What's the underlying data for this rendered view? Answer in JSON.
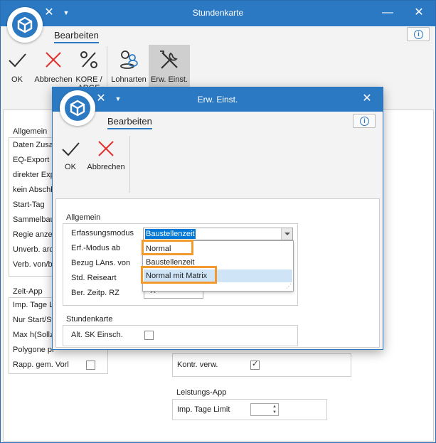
{
  "main_window": {
    "title": "Stundenkarte",
    "ribbon_tab": "Bearbeiten",
    "buttons": {
      "ok": "OK",
      "cancel": "Abbrechen",
      "kore": "KORE /",
      "kore2": "ARGE",
      "lohnarten": "Lohnarten",
      "erw_einst": "Erw. Einst."
    },
    "allgemein": {
      "label": "Allgemein",
      "rows": [
        "Daten Zusar",
        "EQ-Export",
        "direkter Exp",
        "kein Abschlu",
        "Start-Tag",
        "Sammelbaus",
        "Regie anzeig",
        "Unverb. arch",
        "Verb. von/bi"
      ]
    },
    "zeit_app": {
      "label": "Zeit-App",
      "rows": [
        "Imp. Tage Li",
        "Nur Start/St",
        "Max h(Sollz.",
        "Polygone pr",
        "Rapp. gem. Vorl"
      ]
    },
    "kontr_verw_label": "Kontr. verw.",
    "leistungs_app": {
      "label": "Leistungs-App",
      "imp_tage_limit": "Imp. Tage Limit"
    }
  },
  "dialog": {
    "title": "Erw. Einst.",
    "ribbon_tab": "Bearbeiten",
    "buttons": {
      "ok": "OK",
      "cancel": "Abbrechen"
    },
    "allgemein": {
      "label": "Allgemein",
      "erfassungsmodus_label": "Erfassungsmodus",
      "erfassungsmodus_value": "Baustellenzeit",
      "erf_modus_ab_label": "Erf.-Modus ab",
      "bezug_lans_label": "Bezug LAns. von",
      "std_reiseart_label": "Std. Reiseart",
      "ber_zeitp_label": "Ber. Zeitp. RZ"
    },
    "dropdown_options": [
      "Normal",
      "Baustellenzeit",
      "Normal mit Matrix"
    ],
    "stundenkarte": {
      "label": "Stundenkarte",
      "alt_sk_label": "Alt. SK Einsch."
    }
  },
  "colors": {
    "accent": "#2b79c2",
    "highlight": "#f29a2e",
    "selection": "#0078d7"
  }
}
